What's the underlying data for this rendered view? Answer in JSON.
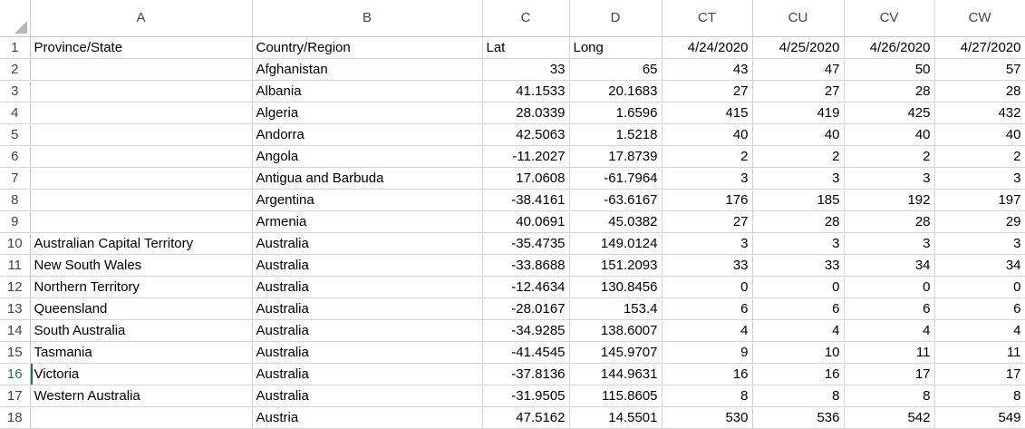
{
  "columns": [
    "A",
    "B",
    "C",
    "D",
    "CT",
    "CU",
    "CV",
    "CW"
  ],
  "active_row": "16",
  "rows": [
    {
      "n": "1",
      "c": [
        "Province/State",
        "Country/Region",
        "Lat",
        "Long",
        "4/24/2020",
        "4/25/2020",
        "4/26/2020",
        "4/27/2020"
      ]
    },
    {
      "n": "2",
      "c": [
        "",
        "Afghanistan",
        "33",
        "65",
        "43",
        "47",
        "50",
        "57"
      ]
    },
    {
      "n": "3",
      "c": [
        "",
        "Albania",
        "41.1533",
        "20.1683",
        "27",
        "27",
        "28",
        "28"
      ]
    },
    {
      "n": "4",
      "c": [
        "",
        "Algeria",
        "28.0339",
        "1.6596",
        "415",
        "419",
        "425",
        "432"
      ]
    },
    {
      "n": "5",
      "c": [
        "",
        "Andorra",
        "42.5063",
        "1.5218",
        "40",
        "40",
        "40",
        "40"
      ]
    },
    {
      "n": "6",
      "c": [
        "",
        "Angola",
        "-11.2027",
        "17.8739",
        "2",
        "2",
        "2",
        "2"
      ]
    },
    {
      "n": "7",
      "c": [
        "",
        "Antigua and Barbuda",
        "17.0608",
        "-61.7964",
        "3",
        "3",
        "3",
        "3"
      ]
    },
    {
      "n": "8",
      "c": [
        "",
        "Argentina",
        "-38.4161",
        "-63.6167",
        "176",
        "185",
        "192",
        "197"
      ]
    },
    {
      "n": "9",
      "c": [
        "",
        "Armenia",
        "40.0691",
        "45.0382",
        "27",
        "28",
        "28",
        "29"
      ]
    },
    {
      "n": "10",
      "c": [
        "Australian Capital Territory",
        "Australia",
        "-35.4735",
        "149.0124",
        "3",
        "3",
        "3",
        "3"
      ]
    },
    {
      "n": "11",
      "c": [
        "New South Wales",
        "Australia",
        "-33.8688",
        "151.2093",
        "33",
        "33",
        "34",
        "34"
      ]
    },
    {
      "n": "12",
      "c": [
        "Northern Territory",
        "Australia",
        "-12.4634",
        "130.8456",
        "0",
        "0",
        "0",
        "0"
      ]
    },
    {
      "n": "13",
      "c": [
        "Queensland",
        "Australia",
        "-28.0167",
        "153.4",
        "6",
        "6",
        "6",
        "6"
      ]
    },
    {
      "n": "14",
      "c": [
        "South Australia",
        "Australia",
        "-34.9285",
        "138.6007",
        "4",
        "4",
        "4",
        "4"
      ]
    },
    {
      "n": "15",
      "c": [
        "Tasmania",
        "Australia",
        "-41.4545",
        "145.9707",
        "9",
        "10",
        "11",
        "11"
      ]
    },
    {
      "n": "16",
      "c": [
        "Victoria",
        "Australia",
        "-37.8136",
        "144.9631",
        "16",
        "16",
        "17",
        "17"
      ]
    },
    {
      "n": "17",
      "c": [
        "Western Australia",
        "Australia",
        "-31.9505",
        "115.8605",
        "8",
        "8",
        "8",
        "8"
      ]
    },
    {
      "n": "18",
      "c": [
        "",
        "Austria",
        "47.5162",
        "14.5501",
        "530",
        "536",
        "542",
        "549"
      ]
    }
  ]
}
